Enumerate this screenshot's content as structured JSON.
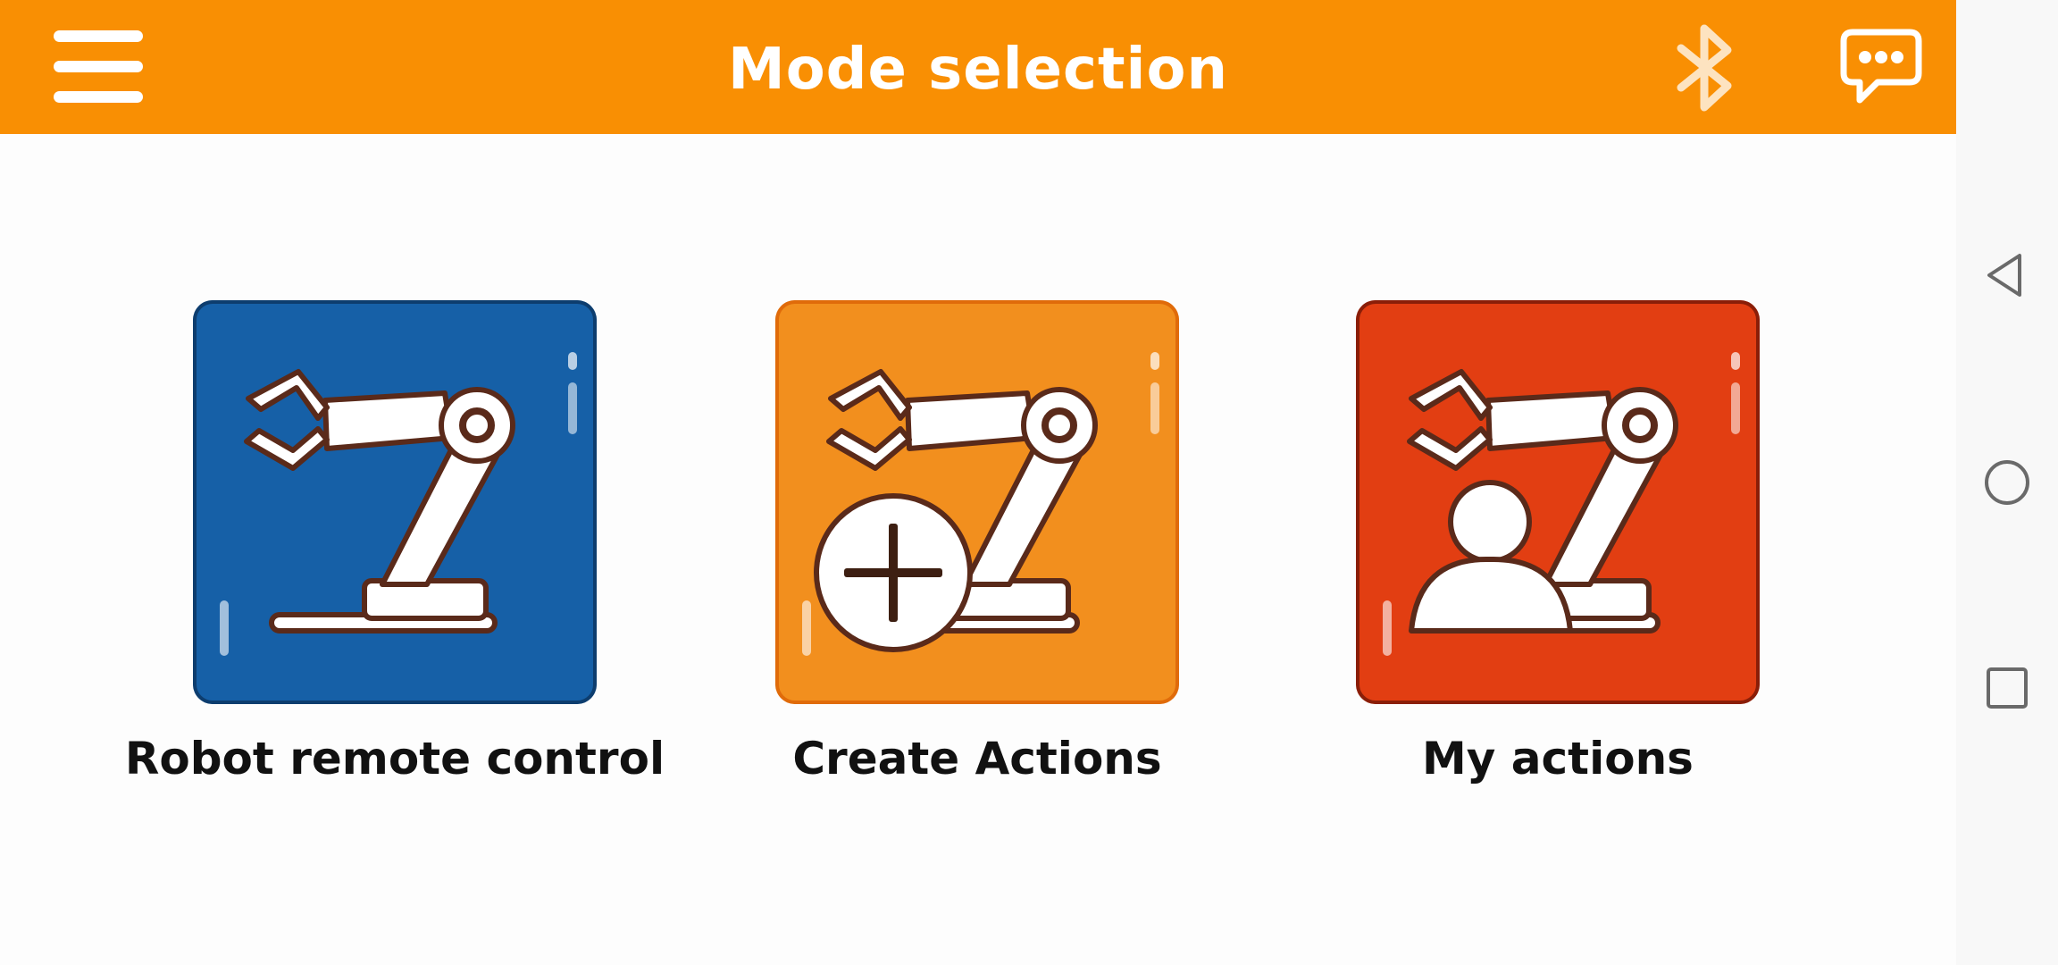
{
  "header": {
    "title": "Mode selection",
    "menu_icon": "hamburger-menu-icon",
    "bluetooth_icon": "bluetooth-icon",
    "chat_icon": "chat-bubble-icon"
  },
  "modes": [
    {
      "label": "Robot remote control",
      "icon": "robot-arm-icon",
      "color": "#1660a7"
    },
    {
      "label": "Create Actions",
      "icon": "robot-arm-add-icon",
      "color": "#f28f1e"
    },
    {
      "label": "My actions",
      "icon": "robot-arm-user-icon",
      "color": "#e23e12"
    }
  ],
  "navigation": {
    "back_icon": "back-triangle-icon",
    "home_icon": "home-circle-icon",
    "recents_icon": "recents-square-icon"
  },
  "colors": {
    "header_bg": "#f98f03",
    "page_bg": "#fdfdfd",
    "nav_bg": "#f8f8f8"
  }
}
